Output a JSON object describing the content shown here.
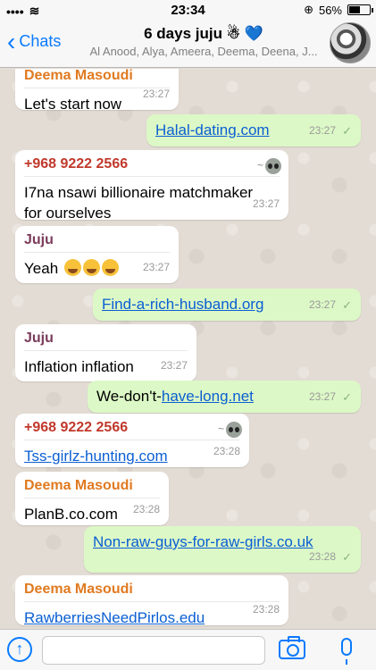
{
  "status": {
    "time": "23:34",
    "battery": "56%",
    "battery_level": 0.56,
    "signal_glyph": "••••",
    "wifi_glyph": "≋"
  },
  "header": {
    "back_label": "Chats",
    "title": "6 days juju",
    "title_emoji": "☃",
    "title_heart": "💙",
    "subtitle": "Al Anood, Alya, Ameera, Deema, Deena, J..."
  },
  "messages": [
    {
      "sender": "Deema Masoudi",
      "text": "Let's start now",
      "time": "23:27"
    },
    {
      "text": "Halal-dating.com",
      "time": "23:27",
      "check": "✓"
    },
    {
      "sender": "+968 9222 2566",
      "tilde": "~",
      "text": "I7na nsawi billionaire matchmaker for ourselves",
      "time": "23:27"
    },
    {
      "sender": "Juju",
      "text": "Yeah",
      "time": "23:27"
    },
    {
      "text": "Find-a-rich-husband.org",
      "time": "23:27",
      "check": "✓"
    },
    {
      "sender": "Juju",
      "text": "Inflation inflation",
      "time": "23:27"
    },
    {
      "text_plain": "We-don't-",
      "text_link": "have-long.net",
      "time": "23:27",
      "check": "✓"
    },
    {
      "sender": "+968 9222 2566",
      "tilde": "~",
      "text": "Tss-girlz-hunting.com",
      "time": "23:28"
    },
    {
      "sender": "Deema Masoudi",
      "text": "PlanB.co.com",
      "time": "23:28"
    },
    {
      "text": "Non-raw-guys-for-raw-girls.co.uk",
      "time": "23:28",
      "check": "✓"
    },
    {
      "sender": "Deema Masoudi",
      "text": "RawberriesNeedPirlos.edu",
      "time": "23:28"
    }
  ],
  "input": {
    "placeholder": ""
  },
  "icons": {
    "back": "chevron-left-icon",
    "attach": "upload-arrow-icon",
    "camera": "camera-icon",
    "mic": "microphone-icon"
  }
}
